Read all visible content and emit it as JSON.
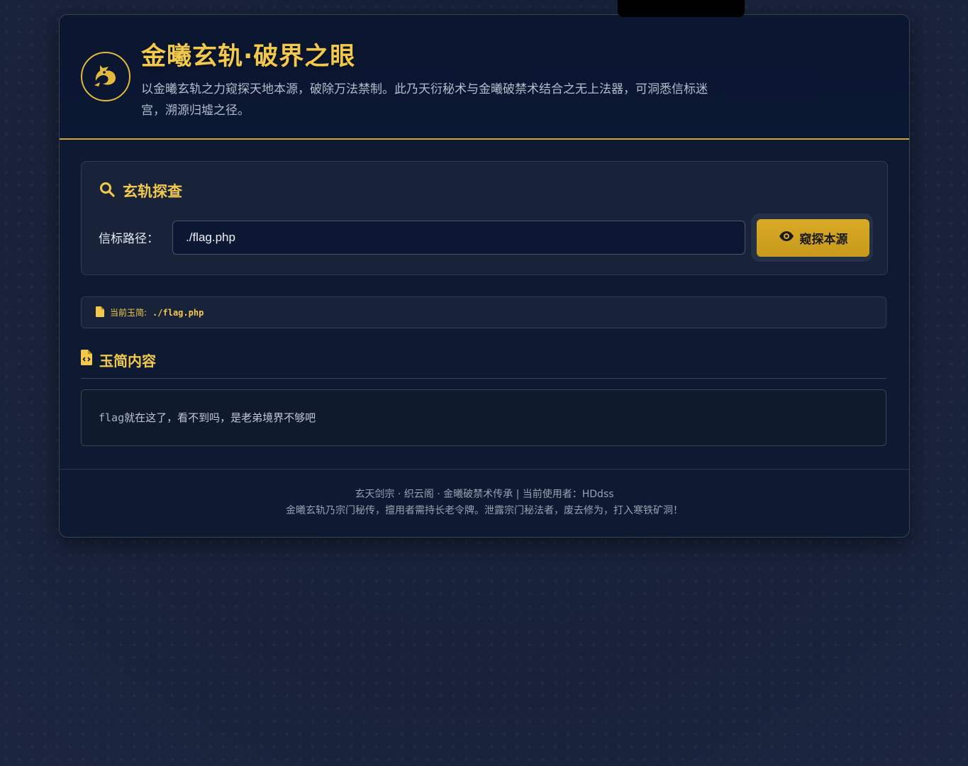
{
  "header": {
    "title": "金曦玄轨·破界之眼",
    "subtitle": "以金曦玄轨之力窥探天地本源，破除万法禁制。此乃天衍秘术与金曦破禁术结合之无上法器，可洞悉信标迷宫，溯源归墟之径。",
    "logo_icon": "dragon-icon"
  },
  "search": {
    "heading": "玄轨探查",
    "heading_icon": "search-icon",
    "path_label": "信标路径：",
    "path_value": "./flag.php",
    "button_label": "窥探本源",
    "button_icon": "eye-icon"
  },
  "current": {
    "label": "当前玉简:",
    "path": "./flag.php",
    "icon": "file-icon"
  },
  "content": {
    "heading": "玉简内容",
    "heading_icon": "file-code-icon",
    "text_prefix": "flag",
    "text_rest": "就在这了，看不到吗，是老弟境界不够吧"
  },
  "footer": {
    "line1": "玄天剑宗 · 织云阁 · 金曦破禁术传承 | 当前使用者：HDdss",
    "line2": "金曦玄轨乃宗门秘传，擅用者需持长老令牌。泄露宗门秘法者，废去修为，打入寒铁矿洞！"
  },
  "colors": {
    "accent": "#f2c94c",
    "button": "#d4a72c",
    "panel": "#0e1a31"
  }
}
